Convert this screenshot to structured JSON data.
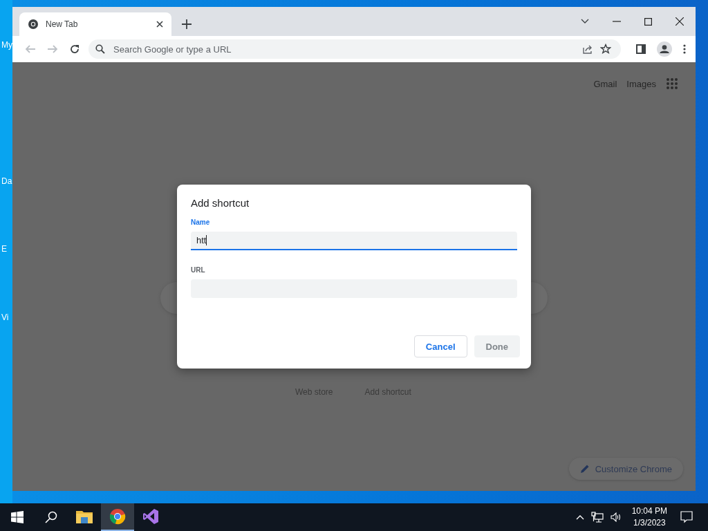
{
  "desktop": {
    "icon_labels": [
      "My",
      "Da",
      "E",
      "Vi"
    ]
  },
  "browser": {
    "tabs": [
      {
        "title": "New Tab",
        "selected": true
      }
    ],
    "omnibox": {
      "placeholder": "Search Google or type a URL"
    },
    "page": {
      "links": [
        "Gmail",
        "Images"
      ],
      "shortcut_labels": [
        "Web store",
        "Add shortcut"
      ],
      "customize_button": "Customize Chrome"
    }
  },
  "dialog": {
    "title": "Add shortcut",
    "fields": [
      {
        "label": "Name",
        "value": "htt",
        "focused": true
      },
      {
        "label": "URL",
        "focused": false
      }
    ],
    "buttons": [
      {
        "label": "Cancel",
        "disabled": false
      },
      {
        "label": "Done",
        "disabled": true
      }
    ]
  },
  "taskbar": {
    "apps": [
      {
        "kind": "explorer",
        "selected": false
      },
      {
        "kind": "chrome",
        "selected": true
      },
      {
        "kind": "visualstudio",
        "selected": false
      }
    ],
    "clock": {
      "time": "10:04 PM",
      "date": "1/3/2023"
    }
  }
}
